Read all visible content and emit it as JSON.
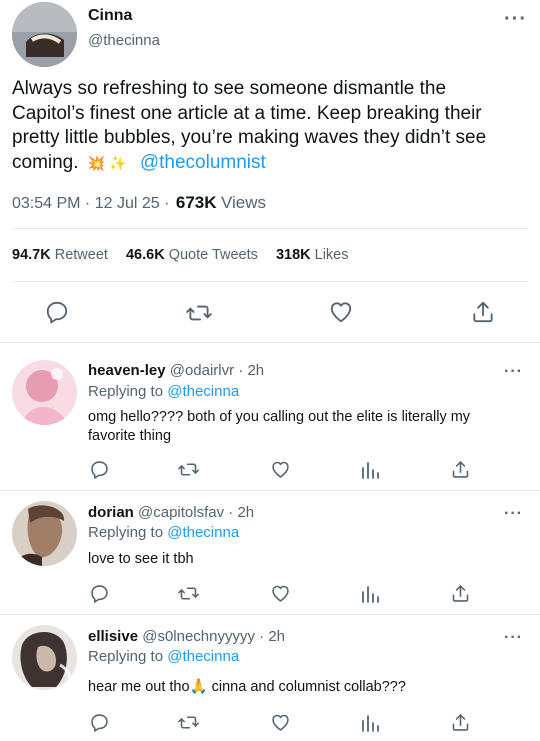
{
  "main_tweet": {
    "display_name": "Cinna",
    "handle": "@thecinna",
    "text_line1": "Always so refreshing to see someone dismantle the",
    "text_line2": "Capitol’s finest one article at a time. Keep breaking their",
    "text_line3": "pretty little bubbles, you’re making waves they didn’t see",
    "text_line4": "coming.",
    "emoji": "💥 ✨",
    "mention": "@thecolumnist",
    "time": "03:54 PM · 12 Jul 25 ·",
    "views_count": "673K",
    "views_label": "Views",
    "retweets_count": "94.7K",
    "retweets_label": "Retweet",
    "quotes_count": "46.6K",
    "quotes_label": "Quote Tweets",
    "likes_count": "318K",
    "likes_label": "Likes"
  },
  "replies": [
    {
      "display_name": "heaven-ley",
      "meta": "@odairlvr · 2h",
      "replying_prefix": "Replying to",
      "replying_to": "@thecinna",
      "text_line1": "omg hello???? both of you calling out the elite is literally my",
      "text_line2": "favorite thing",
      "avatar_color": "#f3c6d4"
    },
    {
      "display_name": "dorian",
      "meta": "@capitolsfav · 2h",
      "replying_prefix": "Replying to",
      "replying_to": "@thecinna",
      "text_line1": "love to see it tbh",
      "avatar_color": "#9a7b66"
    },
    {
      "display_name": "ellisive",
      "meta": "@s0lnechnyyyyy · 2h",
      "replying_prefix": "Replying to",
      "replying_to": "@thecinna",
      "text_line1": "hear me out tho🙏 cinna and columnist collab???",
      "avatar_color": "#5a4e48"
    }
  ],
  "icons": [
    "reply-icon",
    "retweet-icon",
    "like-icon",
    "share-icon",
    "analytics-icon",
    "more-icon"
  ],
  "colors": {
    "link": "#1d9bf0",
    "muted": "#536471",
    "divider": "#e6e9ec"
  }
}
